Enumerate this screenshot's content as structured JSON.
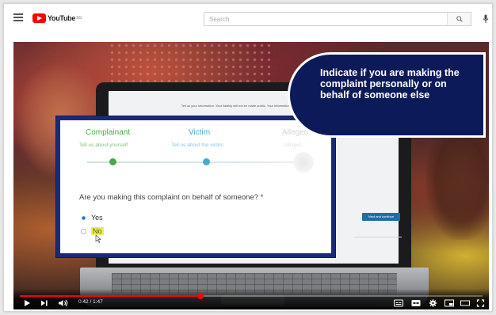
{
  "header": {
    "logo_text": "YouTube",
    "logo_superscript": "SG",
    "search_placeholder": "Search"
  },
  "video": {
    "background_form": {
      "header_text": "Tell us your information. Your liability will not be made public. Your information will be kept confidential.",
      "next_button_label": "Next and continue"
    },
    "form": {
      "steps": [
        {
          "label": "Complainant",
          "sublabel": "Tell us about yourself",
          "color": "#4aa84a",
          "sub_color": "#7fbf7f"
        },
        {
          "label": "Victim",
          "sublabel": "Tell us about the victim",
          "color": "#49a8d8",
          "sub_color": "#8ac6e4"
        },
        {
          "label": "Alleged",
          "sublabel": "Alleged...",
          "color": "#d5d5d5",
          "sub_color": "#e0e0e0"
        }
      ],
      "question": "Are you making this complaint on behalf of someone? *",
      "options": [
        {
          "label": "Yes",
          "selected": true
        },
        {
          "label": "No",
          "selected": false,
          "highlighted": true
        }
      ],
      "border_color": "#1b2a78"
    },
    "callout": {
      "text": "Indicate if you are making the complaint personally or on behalf of someone else",
      "background": "#0d1a5a"
    },
    "controls": {
      "time": "0:42 / 1:47",
      "progress_fraction": 0.39,
      "progress_color": "#ff0000",
      "buttons": [
        "play-icon",
        "next-icon",
        "volume-icon",
        "subtitles-icon",
        "settings-icon",
        "miniplayer-icon",
        "theater-icon",
        "fullscreen-icon"
      ]
    }
  }
}
